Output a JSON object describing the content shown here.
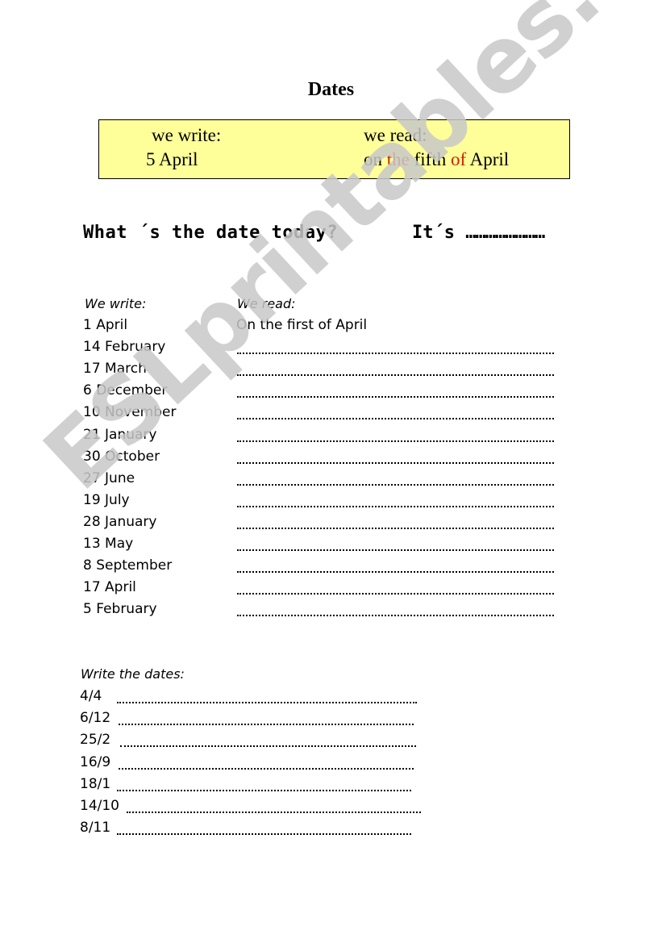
{
  "title": "Dates",
  "example_box": {
    "write_label": "we write:",
    "write_value": "5 April",
    "read_label": "we read:",
    "read_parts": {
      "p1": "on ",
      "p2": "the",
      "p3": " fifth ",
      "p4": "of",
      "p5": " April"
    },
    "highlight_color": "#cc2200",
    "background_color": "#ffff99"
  },
  "question": {
    "text": "What ´s the date today?",
    "answer_prefix": "It´s",
    "answer_blank": "……………………"
  },
  "exercise1": {
    "header_write": "We write:",
    "header_read": "We read:",
    "rows": [
      {
        "date": "1 April",
        "read": "On the first of April"
      },
      {
        "date": "14 February",
        "read": ""
      },
      {
        "date": "17 March",
        "read": ""
      },
      {
        "date": "6 December",
        "read": ""
      },
      {
        "date": "10 November",
        "read": ""
      },
      {
        "date": "21 January",
        "read": ""
      },
      {
        "date": "30 October",
        "read": ""
      },
      {
        "date": "27 June",
        "read": ""
      },
      {
        "date": "19 July",
        "read": ""
      },
      {
        "date": "28 January",
        "read": ""
      },
      {
        "date": "13 May",
        "read": ""
      },
      {
        "date": "8 September",
        "read": ""
      },
      {
        "date": "17 April",
        "read": ""
      },
      {
        "date": "5 February",
        "read": ""
      }
    ]
  },
  "exercise2": {
    "header": "Write the dates:",
    "rows": [
      {
        "code": "4/4"
      },
      {
        "code": "6/12"
      },
      {
        "code": "25/2"
      },
      {
        "code": "16/9"
      },
      {
        "code": "18/1"
      },
      {
        "code": "14/10"
      },
      {
        "code": "8/11"
      }
    ]
  },
  "watermark": "ESLprintables.com"
}
